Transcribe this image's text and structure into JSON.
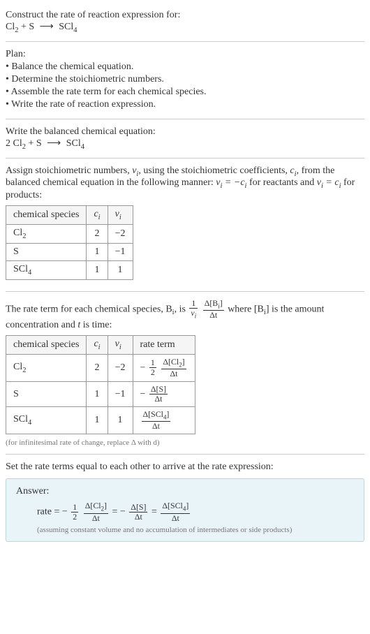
{
  "header": {
    "title": "Construct the rate of reaction expression for:",
    "equation_lhs1": "Cl",
    "equation_lhs1_sub": "2",
    "plus1": " + S ",
    "arrow": "⟶",
    "product": " SCl",
    "product_sub": "4"
  },
  "plan": {
    "title": "Plan:",
    "items": [
      "• Balance the chemical equation.",
      "• Determine the stoichiometric numbers.",
      "• Assemble the rate term for each chemical species.",
      "• Write the rate of reaction expression."
    ]
  },
  "balanced": {
    "title": "Write the balanced chemical equation:",
    "coef1": "2 Cl",
    "sub1": "2",
    "mid": " + S ",
    "arrow": "⟶",
    "prod": " SCl",
    "prod_sub": "4"
  },
  "stoich": {
    "intro_a": "Assign stoichiometric numbers, ",
    "nu_i": "ν",
    "nu_sub": "i",
    "intro_b": ", using the stoichiometric coefficients, ",
    "c_i": "c",
    "c_sub": "i",
    "intro_c": ", from the balanced chemical equation in the following manner: ",
    "rel1_a": "ν",
    "rel1_b": " = −c",
    "rel1_c": " for reactants and ",
    "rel2_a": "ν",
    "rel2_b": " = c",
    "rel2_c": " for products:",
    "headers": [
      "chemical species",
      "c",
      "ν"
    ],
    "header_sub": "i",
    "rows": [
      {
        "species": "Cl",
        "species_sub": "2",
        "c": "2",
        "nu": "−2"
      },
      {
        "species": "S",
        "species_sub": "",
        "c": "1",
        "nu": "−1"
      },
      {
        "species": "SCl",
        "species_sub": "4",
        "c": "1",
        "nu": "1"
      }
    ]
  },
  "rateterm": {
    "intro_a": "The rate term for each chemical species, B",
    "intro_sub": "i",
    "intro_b": ", is ",
    "frac1_num": "1",
    "frac1_den_a": "ν",
    "frac1_den_sub": "i",
    "frac2_num_a": "Δ[B",
    "frac2_num_sub": "i",
    "frac2_num_b": "]",
    "frac2_den": "Δt",
    "intro_c": " where [B",
    "intro_c_sub": "i",
    "intro_d": "] is the amount concentration and ",
    "t_var": "t",
    "intro_e": " is time:",
    "headers": [
      "chemical species",
      "c",
      "ν",
      "rate term"
    ],
    "header_sub": "i",
    "rows": [
      {
        "species": "Cl",
        "species_sub": "2",
        "c": "2",
        "nu": "−2",
        "neg": "−",
        "coef_num": "1",
        "coef_den": "2",
        "rate_num": "Δ[Cl",
        "rate_num_sub": "2",
        "rate_num_b": "]",
        "rate_den": "Δt"
      },
      {
        "species": "S",
        "species_sub": "",
        "c": "1",
        "nu": "−1",
        "neg": "−",
        "coef_num": "",
        "coef_den": "",
        "rate_num": "Δ[S]",
        "rate_num_sub": "",
        "rate_num_b": "",
        "rate_den": "Δt"
      },
      {
        "species": "SCl",
        "species_sub": "4",
        "c": "1",
        "nu": "1",
        "neg": "",
        "coef_num": "",
        "coef_den": "",
        "rate_num": "Δ[SCl",
        "rate_num_sub": "4",
        "rate_num_b": "]",
        "rate_den": "Δt"
      }
    ],
    "note": "(for infinitesimal rate of change, replace Δ with d)"
  },
  "final": {
    "title": "Set the rate terms equal to each other to arrive at the rate expression:"
  },
  "answer": {
    "label": "Answer:",
    "rate_eq": "rate = −",
    "half_num": "1",
    "half_den": "2",
    "t1_num_a": "Δ[Cl",
    "t1_num_sub": "2",
    "t1_num_b": "]",
    "t1_den": "Δt",
    "eq1": " = −",
    "t2_num": "Δ[S]",
    "t2_den": "Δt",
    "eq2": " = ",
    "t3_num_a": "Δ[SCl",
    "t3_num_sub": "4",
    "t3_num_b": "]",
    "t3_den": "Δt",
    "assume": "(assuming constant volume and no accumulation of intermediates or side products)"
  }
}
